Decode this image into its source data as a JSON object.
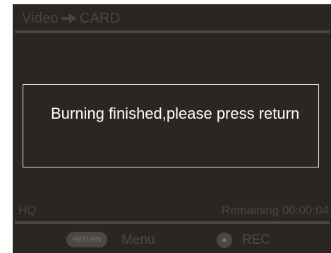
{
  "header": {
    "source": "Video",
    "destination": "CARD",
    "arrow_icon": "right-arrow-icon"
  },
  "dialog": {
    "message": "Burning finished,please press return"
  },
  "status": {
    "quality": "HQ",
    "remaining": "Remaining 00:00:04"
  },
  "footer": {
    "return_button_label": "RETURN",
    "menu_label": "Menu",
    "rec_icon": "record-icon",
    "rec_label": "REC"
  },
  "colors": {
    "screen_background": "#2b2623",
    "dim_text": "#4a4541",
    "dialog_border": "#ece9e6",
    "dialog_text": "#ffffff"
  }
}
